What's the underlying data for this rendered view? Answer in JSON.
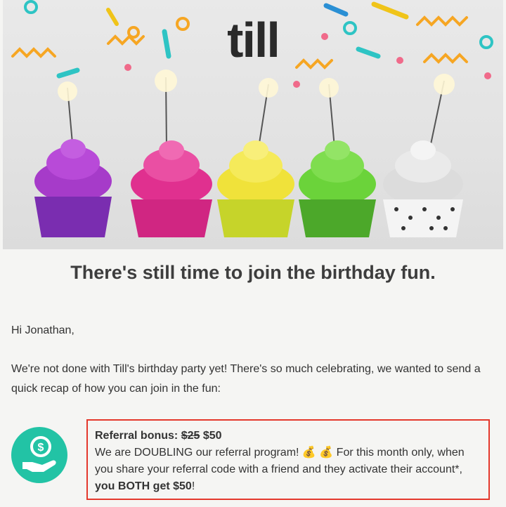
{
  "brand": {
    "logo_text": "till"
  },
  "headline": "There's still time to join the birthday fun.",
  "greeting": "Hi Jonathan,",
  "intro": "We're not done with Till's birthday party yet! There's so much celebrating, we wanted to send a quick recap of how you can join in the fun:",
  "referral": {
    "icon": "hand-dollar-icon",
    "title_prefix": "Referral bonus:",
    "old_amount": "$25",
    "new_amount": "$50",
    "body_1": "We are DOUBLING our referral program!",
    "emoji": "💰 💰",
    "body_2": "For this month only, when you share your referral code with a friend and they activate their account*,",
    "body_bold": "you BOTH get $50",
    "body_end": "!"
  },
  "colors": {
    "accent": "#22c3a5",
    "highlight_border": "#e4382c",
    "cupcakes": [
      "#a63bc9",
      "#e0308f",
      "#f0e23a",
      "#6bd33a",
      "#dcdcdc"
    ]
  }
}
